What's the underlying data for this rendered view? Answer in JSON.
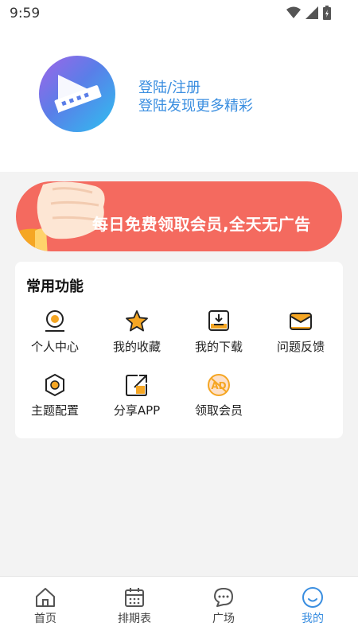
{
  "status": {
    "time": "9:59"
  },
  "profile": {
    "login_title": "登陆/注册",
    "login_subtitle": "登陆发现更多精彩"
  },
  "banner": {
    "text": "每日免费领取会员,全天无广告"
  },
  "functions": {
    "title": "常用功能",
    "items": [
      {
        "label": "个人中心",
        "icon": "person-icon"
      },
      {
        "label": "我的收藏",
        "icon": "star-icon"
      },
      {
        "label": "我的下载",
        "icon": "download-icon"
      },
      {
        "label": "问题反馈",
        "icon": "mail-icon"
      },
      {
        "label": "主题配置",
        "icon": "theme-icon"
      },
      {
        "label": "分享APP",
        "icon": "share-icon"
      },
      {
        "label": "领取会员",
        "icon": "no-ad-icon"
      }
    ]
  },
  "tabbar": {
    "active": "我的",
    "items": [
      {
        "label": "首页",
        "icon": "home-icon"
      },
      {
        "label": "排期表",
        "icon": "calendar-icon"
      },
      {
        "label": "广场",
        "icon": "chat-icon"
      },
      {
        "label": "我的",
        "icon": "smile-icon"
      }
    ]
  },
  "colors": {
    "accent": "#3a8ee0",
    "banner": "#f46a5f",
    "icon_orange": "#f5a623"
  }
}
